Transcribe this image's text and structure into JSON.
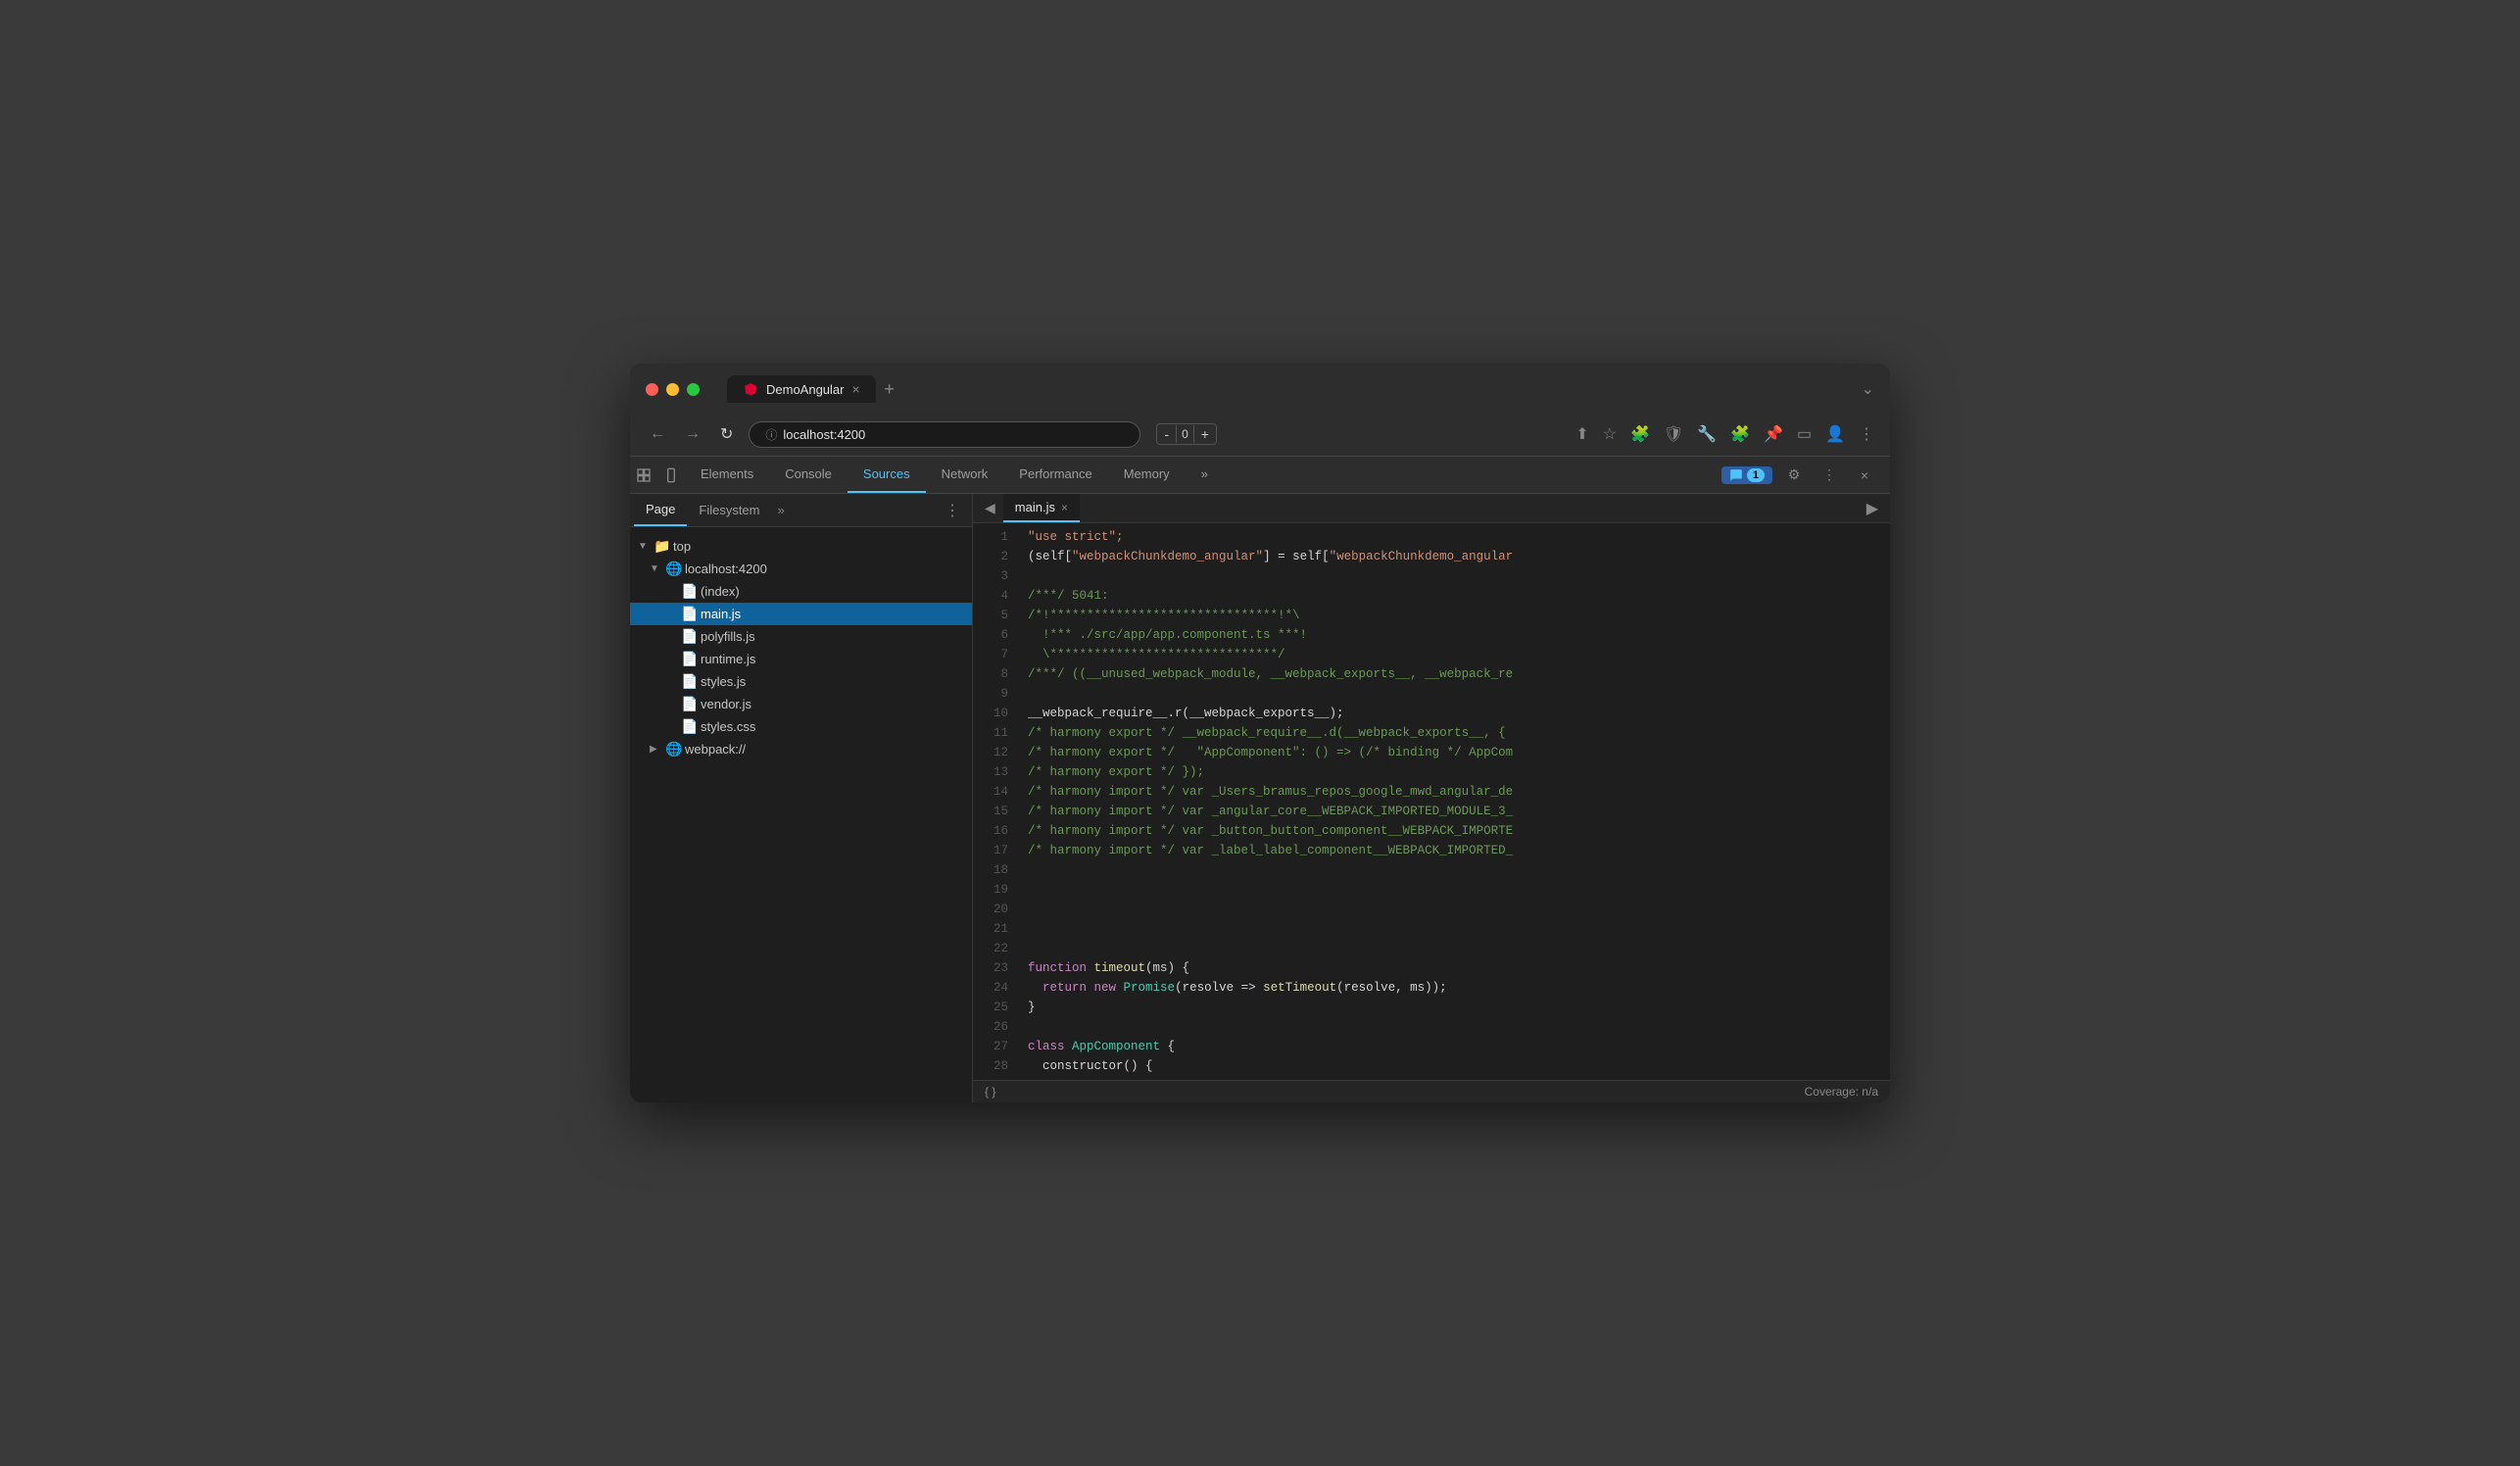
{
  "browser": {
    "title": "DemoAngular",
    "tab_close": "×",
    "tab_new": "+",
    "url": "localhost:4200",
    "window_collapse": "⌄"
  },
  "nav": {
    "back": "←",
    "forward": "→",
    "refresh": "↻",
    "url_icon": "ⓘ",
    "share": "↑",
    "bookmark": "☆",
    "extensions": "🧩",
    "puzzle": "🧩",
    "pin": "📌",
    "user": "👤",
    "menu": "⋮"
  },
  "zoom": {
    "minus": "-",
    "value": "0",
    "plus": "+"
  },
  "devtools": {
    "tabs": [
      "Elements",
      "Console",
      "Sources",
      "Network",
      "Performance",
      "Memory"
    ],
    "active_tab": "Sources",
    "more_tabs": "»",
    "badge": "1",
    "settings_icon": "⚙",
    "more_icon": "⋮",
    "close_icon": "×"
  },
  "file_panel": {
    "tabs": [
      "Page",
      "Filesystem"
    ],
    "active_tab": "Page",
    "more": "»",
    "options": "⋮",
    "collapse_left": "◀",
    "tree": {
      "top": {
        "label": "top",
        "arrow": "▼",
        "icon": "📁"
      },
      "localhost": {
        "label": "localhost:4200",
        "arrow": "▼",
        "icon": "🌐"
      },
      "files": [
        {
          "name": "(index)",
          "icon": "📄",
          "selected": false
        },
        {
          "name": "main.js",
          "icon": "📄",
          "selected": true
        },
        {
          "name": "polyfills.js",
          "icon": "📄",
          "selected": false
        },
        {
          "name": "runtime.js",
          "icon": "📄",
          "selected": false
        },
        {
          "name": "styles.js",
          "icon": "📄",
          "selected": false
        },
        {
          "name": "vendor.js",
          "icon": "📄",
          "selected": false
        },
        {
          "name": "styles.css",
          "icon": "📄",
          "selected": false
        }
      ],
      "webpack": {
        "label": "webpack://",
        "arrow": "▶",
        "icon": "🌐"
      }
    }
  },
  "code_panel": {
    "tab_name": "main.js",
    "tab_close": "×",
    "collapse_right": "▶",
    "lines": [
      {
        "num": 1,
        "content": [
          {
            "t": "string",
            "v": "\"use strict\";"
          }
        ]
      },
      {
        "num": 2,
        "content": [
          {
            "t": "plain",
            "v": "(self[\"webpackChunkdemo_angular\"] = self[\"webpackChunkdemo_angular"
          }
        ]
      },
      {
        "num": 3,
        "content": []
      },
      {
        "num": 4,
        "content": [
          {
            "t": "comment",
            "v": "/***/ 5041:"
          }
        ]
      },
      {
        "num": 5,
        "content": [
          {
            "t": "comment",
            "v": "/*!*******************************!*\\"
          }
        ]
      },
      {
        "num": 6,
        "content": [
          {
            "t": "comment",
            "v": "  !*** ./src/app/app.component.ts ***!"
          }
        ]
      },
      {
        "num": 7,
        "content": [
          {
            "t": "comment",
            "v": "  \\*******************************/"
          }
        ]
      },
      {
        "num": 8,
        "content": [
          {
            "t": "comment",
            "v": "/***/ ((__unused_webpack_module, __webpack_exports__, __webpack_re"
          }
        ]
      },
      {
        "num": 9,
        "content": []
      },
      {
        "num": 10,
        "content": [
          {
            "t": "plain",
            "v": "__webpack_require__.r(__webpack_exports__);"
          }
        ]
      },
      {
        "num": 11,
        "content": [
          {
            "t": "comment",
            "v": "/* harmony export */ __webpack_require__.d(__webpack_exports__, {"
          }
        ]
      },
      {
        "num": 12,
        "content": [
          {
            "t": "comment",
            "v": "/* harmony export */   \"AppComponent\": () => (/* binding */ AppCom"
          }
        ]
      },
      {
        "num": 13,
        "content": [
          {
            "t": "comment",
            "v": "/* harmony export */ });"
          }
        ]
      },
      {
        "num": 14,
        "content": [
          {
            "t": "comment",
            "v": "/* harmony import */ var _Users_bramus_repos_google_mwd_angular_de"
          }
        ]
      },
      {
        "num": 15,
        "content": [
          {
            "t": "comment",
            "v": "/* harmony import */ var _angular_core__WEBPACK_IMPORTED_MODULE_3_"
          }
        ]
      },
      {
        "num": 16,
        "content": [
          {
            "t": "comment",
            "v": "/* harmony import */ var _button_button_component__WEBPACK_IMPORTE"
          }
        ]
      },
      {
        "num": 17,
        "content": [
          {
            "t": "comment",
            "v": "/* harmony import */ var _label_label_component__WEBPACK_IMPORTED_"
          }
        ]
      },
      {
        "num": 18,
        "content": []
      },
      {
        "num": 19,
        "content": []
      },
      {
        "num": 20,
        "content": []
      },
      {
        "num": 21,
        "content": []
      },
      {
        "num": 22,
        "content": []
      },
      {
        "num": 23,
        "content": [
          {
            "t": "keyword",
            "v": "function "
          },
          {
            "t": "function",
            "v": "timeout"
          },
          {
            "t": "plain",
            "v": "(ms) {"
          }
        ]
      },
      {
        "num": 24,
        "content": [
          {
            "t": "plain",
            "v": "  "
          },
          {
            "t": "keyword",
            "v": "return "
          },
          {
            "t": "keyword",
            "v": "new "
          },
          {
            "t": "type",
            "v": "Promise"
          },
          {
            "t": "plain",
            "v": "(resolve => "
          },
          {
            "t": "function",
            "v": "setTimeout"
          },
          {
            "t": "plain",
            "v": "(resolve, ms));"
          }
        ]
      },
      {
        "num": 25,
        "content": [
          {
            "t": "plain",
            "v": "}"
          }
        ]
      },
      {
        "num": 26,
        "content": []
      },
      {
        "num": 27,
        "content": [
          {
            "t": "keyword",
            "v": "class "
          },
          {
            "t": "type",
            "v": "AppComponent"
          },
          {
            "t": "plain",
            "v": " {"
          }
        ]
      },
      {
        "num": 28,
        "content": [
          {
            "t": "plain",
            "v": "  constructor() {"
          }
        ]
      }
    ],
    "footer_left": "{ }",
    "footer_right": "Coverage: n/a"
  }
}
